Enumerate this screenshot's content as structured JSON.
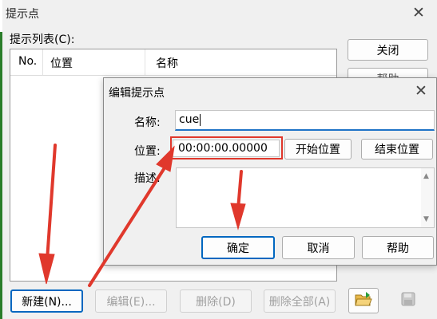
{
  "main_window": {
    "title": "提示点",
    "close_glyph": "✕",
    "list_label": "提示列表(C):",
    "columns": [
      "No.",
      "位置",
      "名称"
    ],
    "side_buttons": {
      "close": "关闭",
      "help_partial": "帮助"
    },
    "bottom_buttons": {
      "new": "新建(N)...",
      "edit": "编辑(E)...",
      "delete": "删除(D)",
      "delete_all": "删除全部(A)"
    },
    "icons": [
      "folder-open-icon",
      "save-disk-icon"
    ]
  },
  "dialog": {
    "title": "编辑提示点",
    "close_glyph": "✕",
    "name_label": "名称:",
    "name_value": "cue",
    "position_label": "位置:",
    "position_value": "00:00:00.00000",
    "start_button": "开始位置",
    "end_button": "结束位置",
    "description_label": "描述:",
    "ok_button": "确定",
    "cancel_button": "取消",
    "help_button": "帮助"
  },
  "colors": {
    "accent_blue": "#0067c0",
    "annotation_red": "#e0382c",
    "window_bg": "#f0f0f0"
  }
}
